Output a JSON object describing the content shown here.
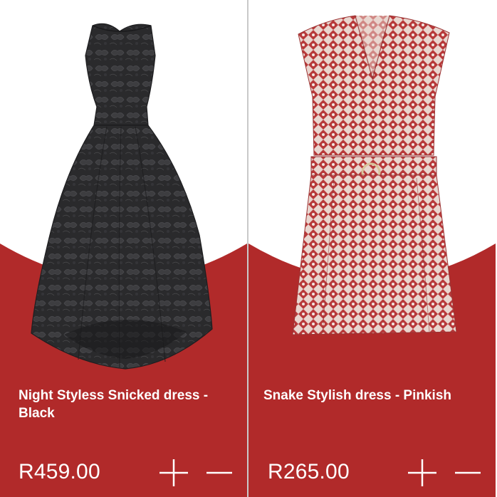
{
  "colors": {
    "accent": "#b12a2a",
    "background": "#ffffff",
    "text_on_accent": "#ffffff",
    "divider": "#c9c9c9"
  },
  "products": [
    {
      "name": "Night Styless Snicked dress - Black",
      "price": "R459.00",
      "image": "black-high-low-lace-dress"
    },
    {
      "name": "Snake Stylish dress - Pinkish",
      "price": "R265.00",
      "image": "red-patterned-belted-dress"
    }
  ],
  "icons": {
    "add": "plus-icon",
    "remove": "minus-icon"
  }
}
